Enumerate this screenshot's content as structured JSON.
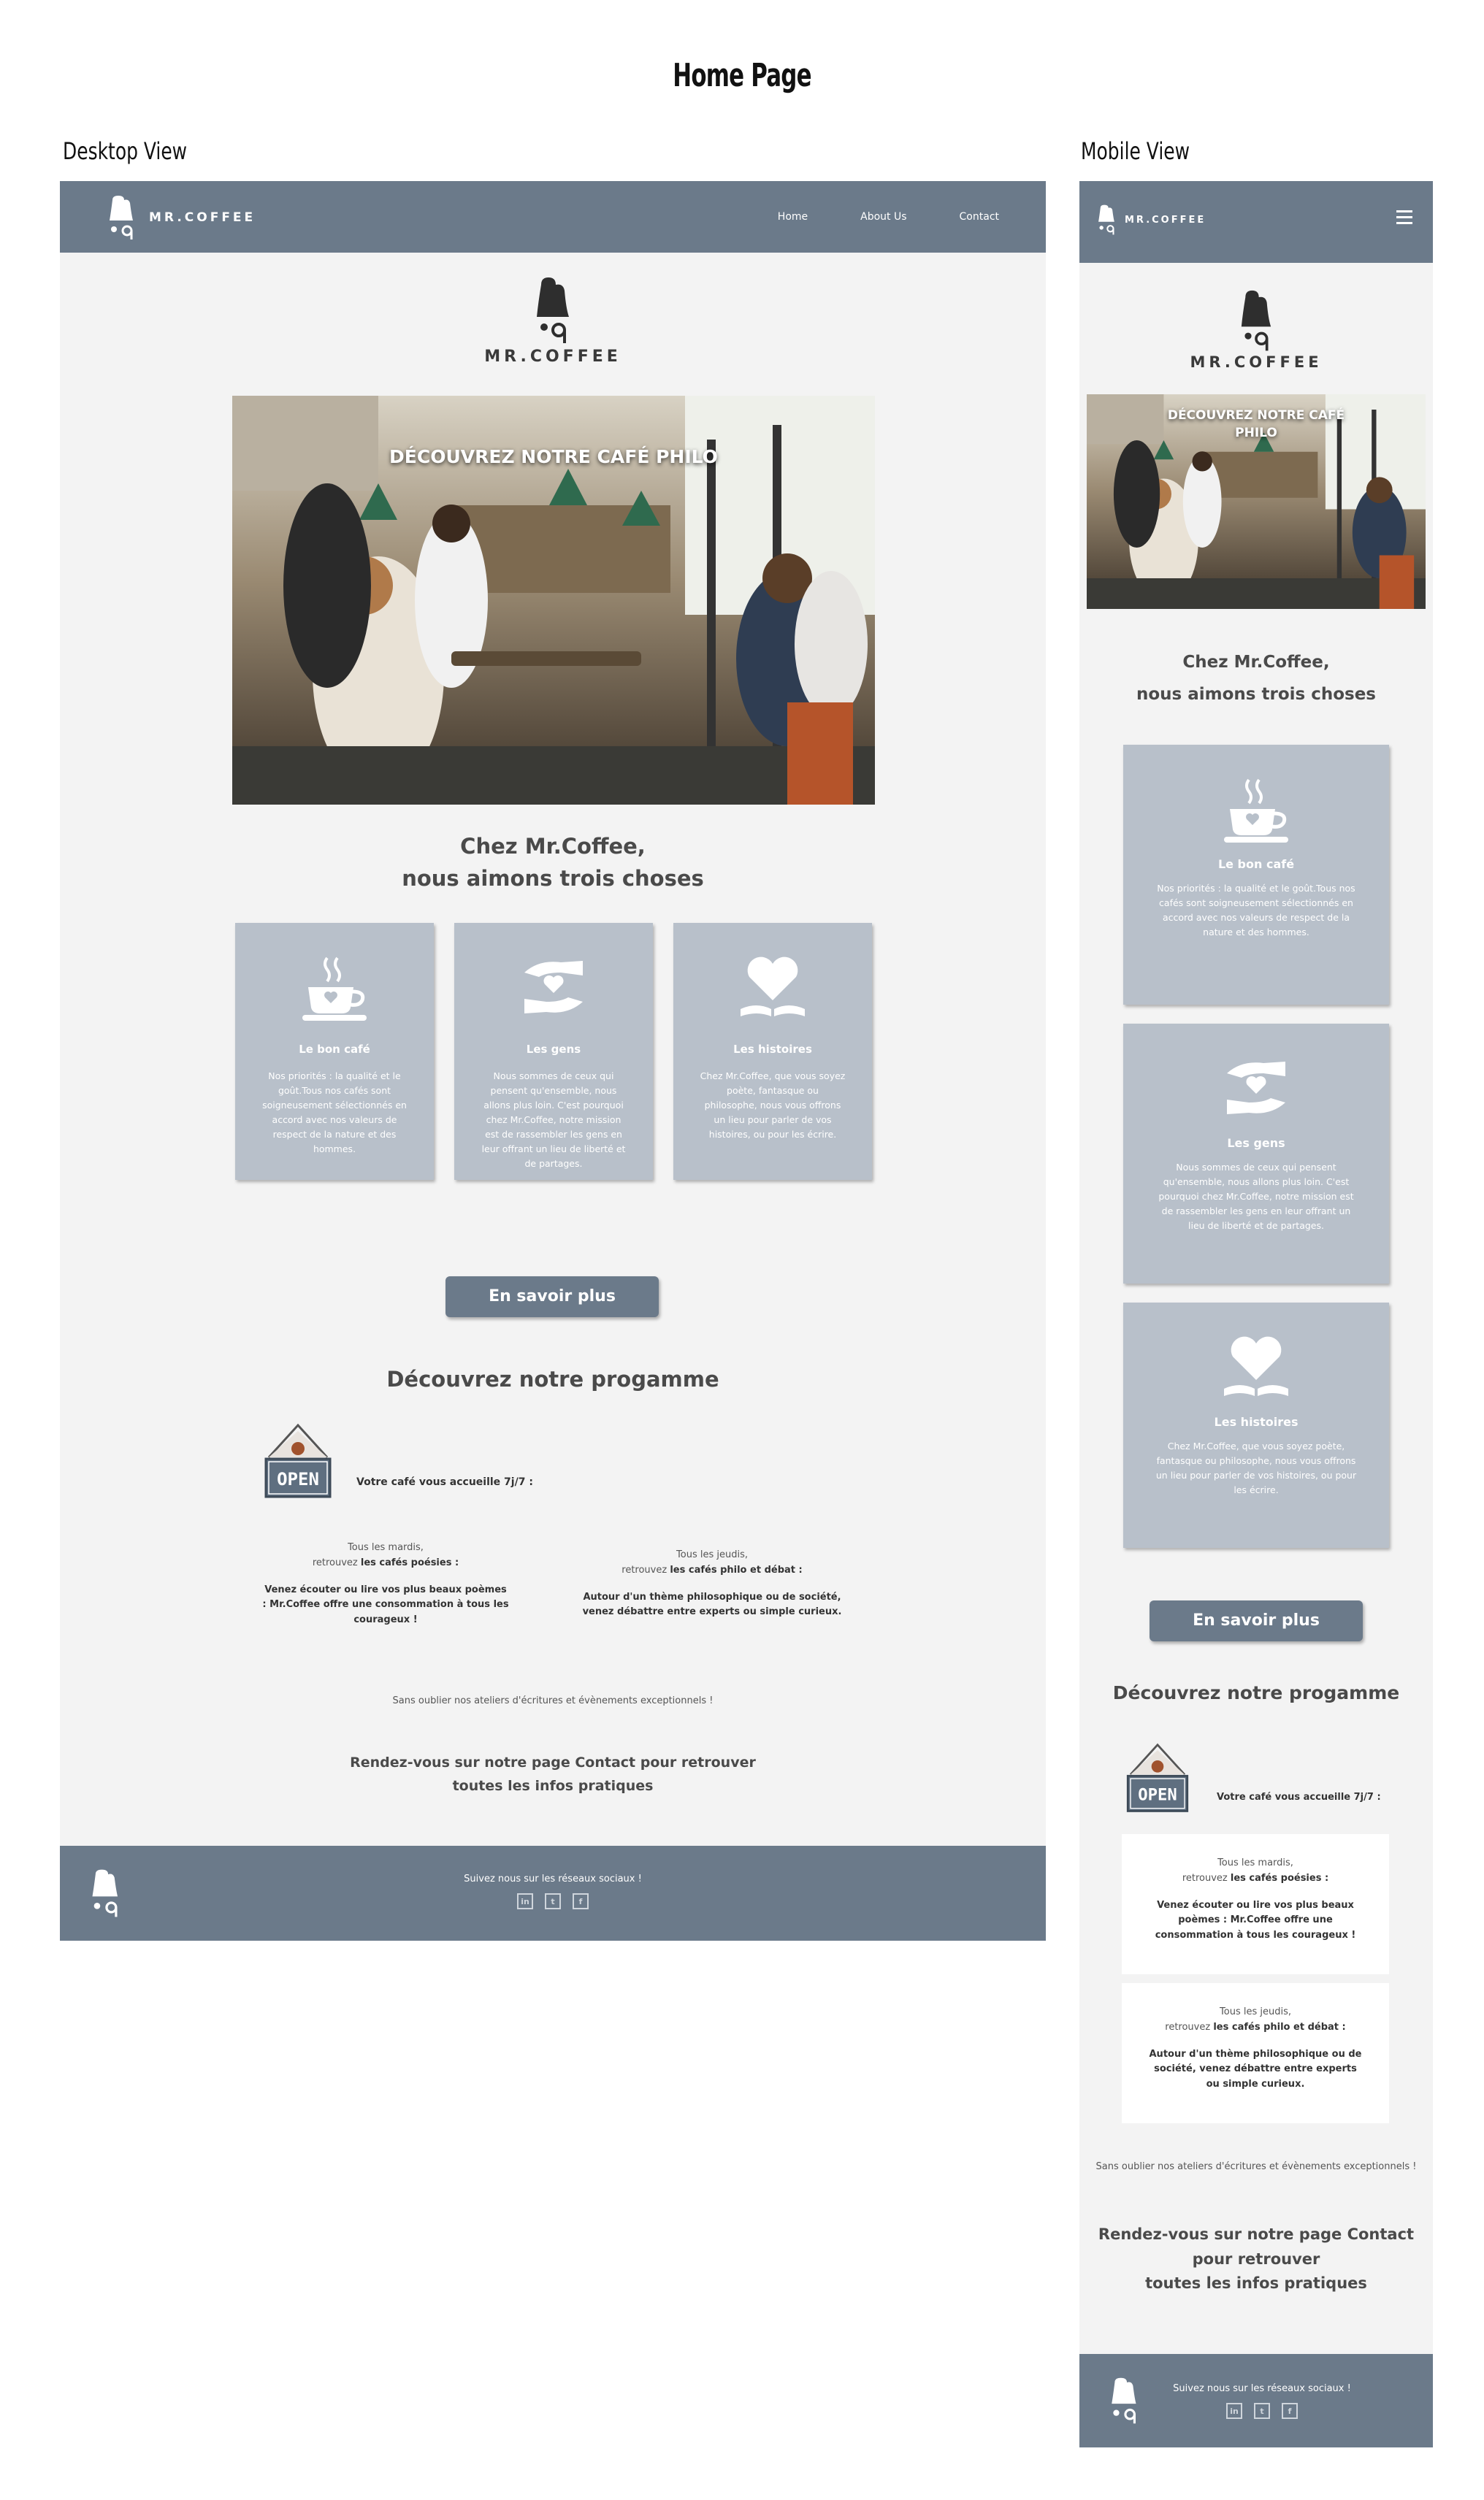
{
  "header": {
    "title": "Home Page",
    "desktop_label": "Desktop View",
    "mobile_label": "Mobile View"
  },
  "brand": {
    "name": "MR.COFFEE"
  },
  "nav": {
    "links": [
      "Home",
      "About Us",
      "Contact"
    ],
    "menu_icon": "hamburger-icon"
  },
  "hero": {
    "title": "DÉCOUVREZ NOTRE CAFÉ PHILO"
  },
  "intro": {
    "line1": "Chez Mr.Coffee,",
    "line2": "nous aimons trois choses"
  },
  "cards": [
    {
      "icon": "coffee-cup-icon",
      "title": "Le bon café",
      "text": "Nos priorités : la qualité et le goût.Tous nos cafés sont soigneusement sélectionnés en accord avec nos valeurs de respect de la nature et des hommes."
    },
    {
      "icon": "caring-hands-icon",
      "title": "Les gens",
      "text": "Nous sommes de ceux qui pensent qu'ensemble, nous allons plus loin. C'est pourquoi chez Mr.Coffee, notre mission est de rassembler les gens en leur offrant un lieu de liberté et de partages."
    },
    {
      "icon": "heart-book-icon",
      "title": "Les histoires",
      "text": "Chez Mr.Coffee, que vous soyez poète, fantasque ou philosophe, nous vous offrons un lieu pour parler de vos histoires, ou pour les écrire."
    }
  ],
  "cta": {
    "label": "En savoir plus"
  },
  "program": {
    "title": "Découvrez notre progamme",
    "open_sign": "OPEN",
    "welcome": "Votre café vous accueille 7j/7 :",
    "tuesday": {
      "line1": "Tous les mardis,",
      "pre": "retrouvez ",
      "bold": "les cafés poésies :",
      "desc": "Venez écouter ou lire vos plus beaux poèmes : Mr.Coffee offre une consommation à tous les courageux !"
    },
    "thursday": {
      "line1": "Tous les jeudis,",
      "pre": "retrouvez ",
      "bold": "les cafés philo et débat :",
      "desc": "Autour d'un thème philosophique ou de société, venez débattre entre experts ou simple curieux."
    },
    "workshops": "Sans oublier nos ateliers d'écritures et évènements exceptionnels !",
    "contact_desktop": [
      "Rendez-vous sur notre page Contact pour retrouver",
      "toutes les infos pratiques"
    ],
    "contact_mobile": [
      "Rendez-vous sur notre page Contact",
      "pour retrouver",
      "toutes les infos pratiques"
    ]
  },
  "footer": {
    "text": "Suivez nous sur les réseaux sociaux !",
    "social": [
      "linkedin-icon",
      "twitter-icon",
      "facebook-icon"
    ]
  },
  "colors": {
    "nav": "#6b7a8a",
    "card": "#b8c0ca",
    "background": "#f3f3f3"
  }
}
